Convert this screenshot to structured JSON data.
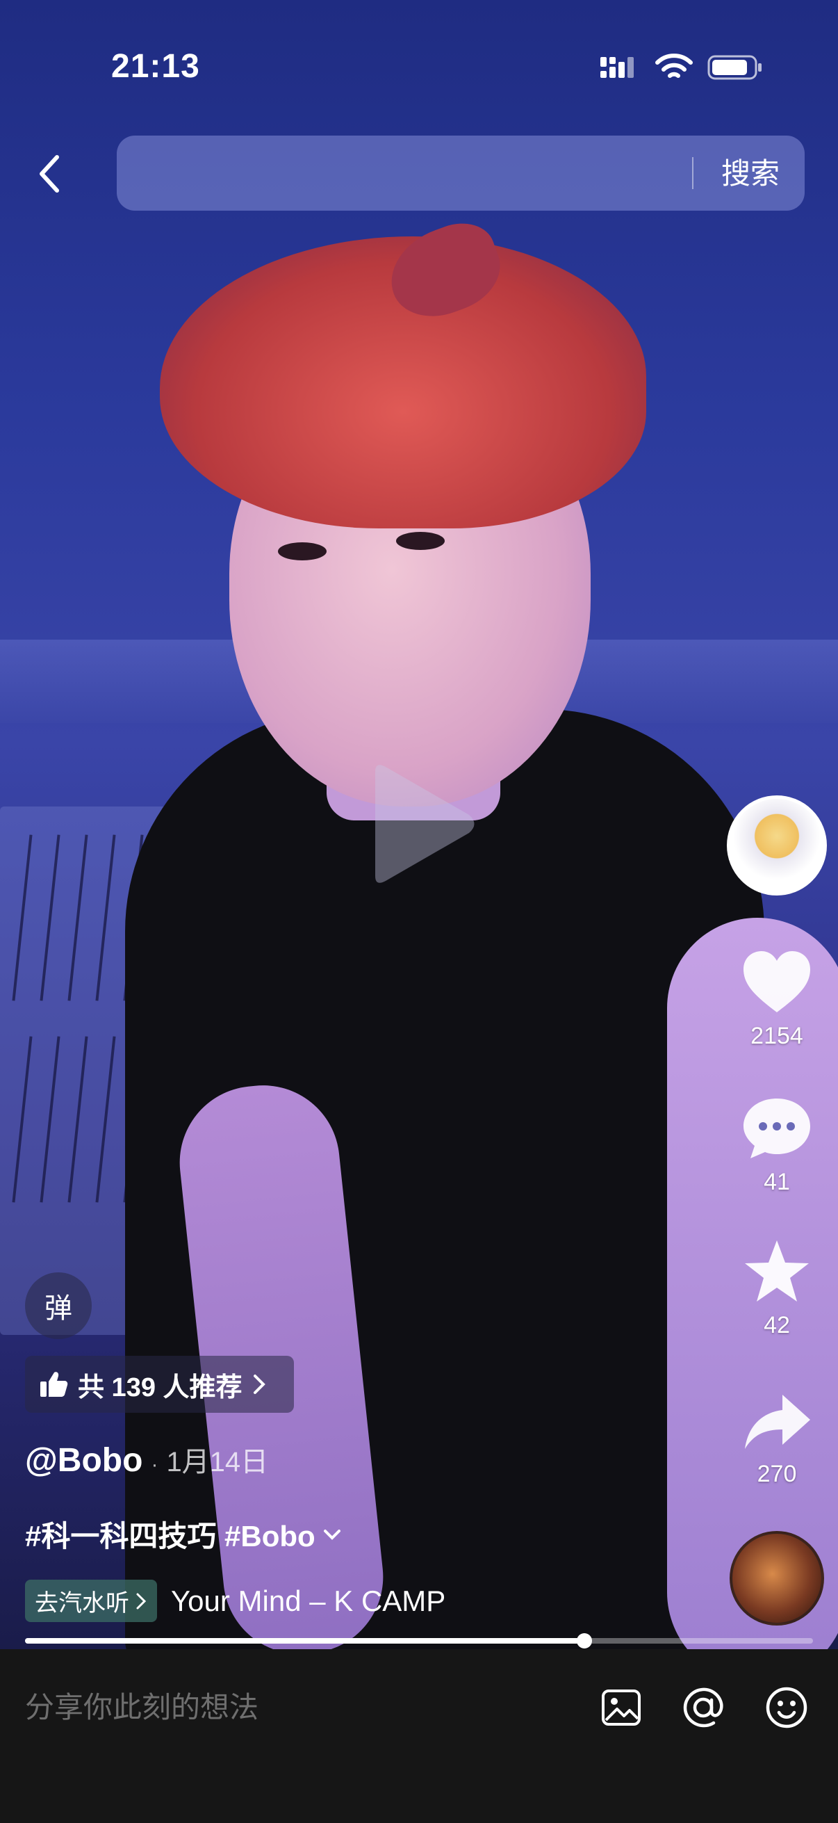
{
  "status_bar": {
    "time": "21:13"
  },
  "search": {
    "button_label": "搜索",
    "placeholder": ""
  },
  "video": {
    "description": "short video frame"
  },
  "rail": {
    "likes": "2154",
    "comments": "41",
    "favorites": "42",
    "shares": "270"
  },
  "danmu_label": "弹",
  "recommend": {
    "label": "共 139 人推荐"
  },
  "post": {
    "author": "@Bobo",
    "date": "1月14日",
    "tags": "#科一科四技巧 #Bobo"
  },
  "music": {
    "qishui_label": "去汽水听",
    "song": "Your Mind – K CAMP"
  },
  "progress": {
    "fraction": 0.71
  },
  "comment_bar": {
    "placeholder": "分享你此刻的想法"
  }
}
